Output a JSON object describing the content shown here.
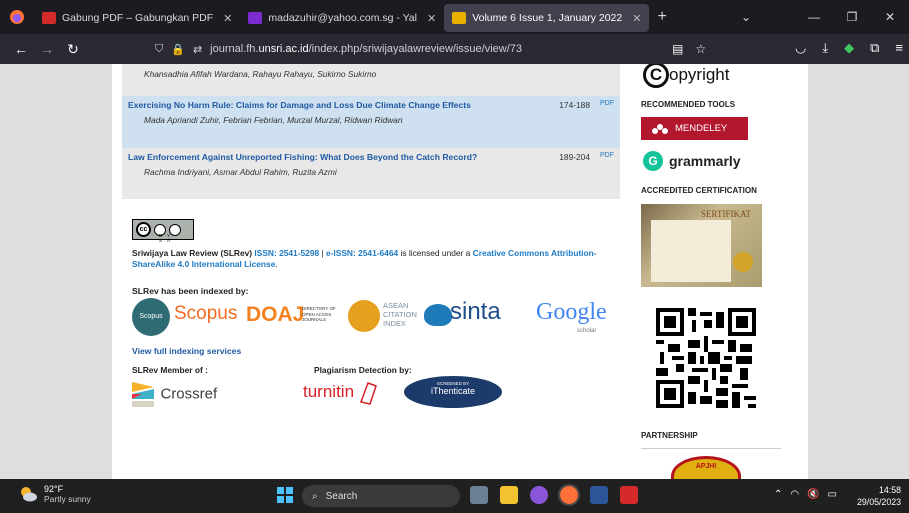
{
  "browser": {
    "tabs": [
      {
        "label": "Gabung PDF – Gabungkan PDF",
        "active": false,
        "color": "#d42a2a"
      },
      {
        "label": "madazuhir@yahoo.com.sg - Yal",
        "active": false,
        "color": "#7b2bd0"
      },
      {
        "label": "Volume 6 Issue 1, January 2022",
        "active": true,
        "color": "#e8b100"
      }
    ],
    "new_tab": "+",
    "url_prefix": "journal.fh.",
    "url_domain": "unsri.ac.id",
    "url_path": "/index.php/sriwijayalawreview/issue/view/73"
  },
  "articles": [
    {
      "title": "",
      "authors": "Khansadhia Afifah Wardana, Rahayu Rahayu, Sukirno Sukirno",
      "pages": "",
      "pdf": ""
    },
    {
      "title": "Exercising No Harm Rule: Claims for Damage and Loss Due Climate Change Effects",
      "authors": "Mada Apriandi Zuhir, Febrian Febrian, Murzal Murzal, Ridwan Ridwan",
      "pages": "174-188",
      "pdf": "PDF"
    },
    {
      "title": "Law Enforcement Against Unreported Fishing: What Does Beyond the Catch Record?",
      "authors": "Rachma Indriyani, Asmar Abdul Rahim, Ruzita Azmi",
      "pages": "189-204",
      "pdf": "PDF"
    }
  ],
  "license": {
    "cc_badge": "BY SA",
    "journal": "Sriwijaya Law Review (SLRev)",
    "issn": "ISSN: 2541-5298",
    "sep": " | ",
    "eissn": "e-ISSN: 2541-6464",
    "mid": " is licensed under a ",
    "license_link": "Creative Commons Attribution-ShareAlike 4.0 International License",
    "end": "."
  },
  "indexing": {
    "heading": "SLRev has been indexed by:",
    "logos": {
      "scopus_badge": "Scopus",
      "scopus": "Scopus",
      "doaj": "DOAJ",
      "doaj_sub": "DIRECTORY OF OPEN ACCES JOURNALS",
      "asean": "ASEAN CITATION INDEX",
      "sinta": "sinta",
      "google": "Google",
      "google_sub": "scholar"
    },
    "full_link": "View full indexing services"
  },
  "member": {
    "heading": "SLRev Member of :",
    "crossref": "Crossref"
  },
  "plagiarism": {
    "heading": "Plagiarism Detection by:",
    "turnitin": "turnitin",
    "ithenticate_top": "SCREENED BY",
    "ithenticate": "iThenticate"
  },
  "sidebar": {
    "copyright": "opyright",
    "copyright_c": "C",
    "recommended_tools": "RECOMMENDED TOOLS",
    "mendeley": "MENDELEY",
    "grammarly": "grammarly",
    "accredited": "ACCREDITED CERTIFICATION",
    "cert_title": "SERTIFIKAT",
    "partnership": "PARTNERSHIP",
    "apjhi": "APJHI"
  },
  "taskbar": {
    "temp": "92°F",
    "weather": "Partly sunny",
    "search": "Search",
    "time": "14:58",
    "date": "29/05/2023"
  }
}
